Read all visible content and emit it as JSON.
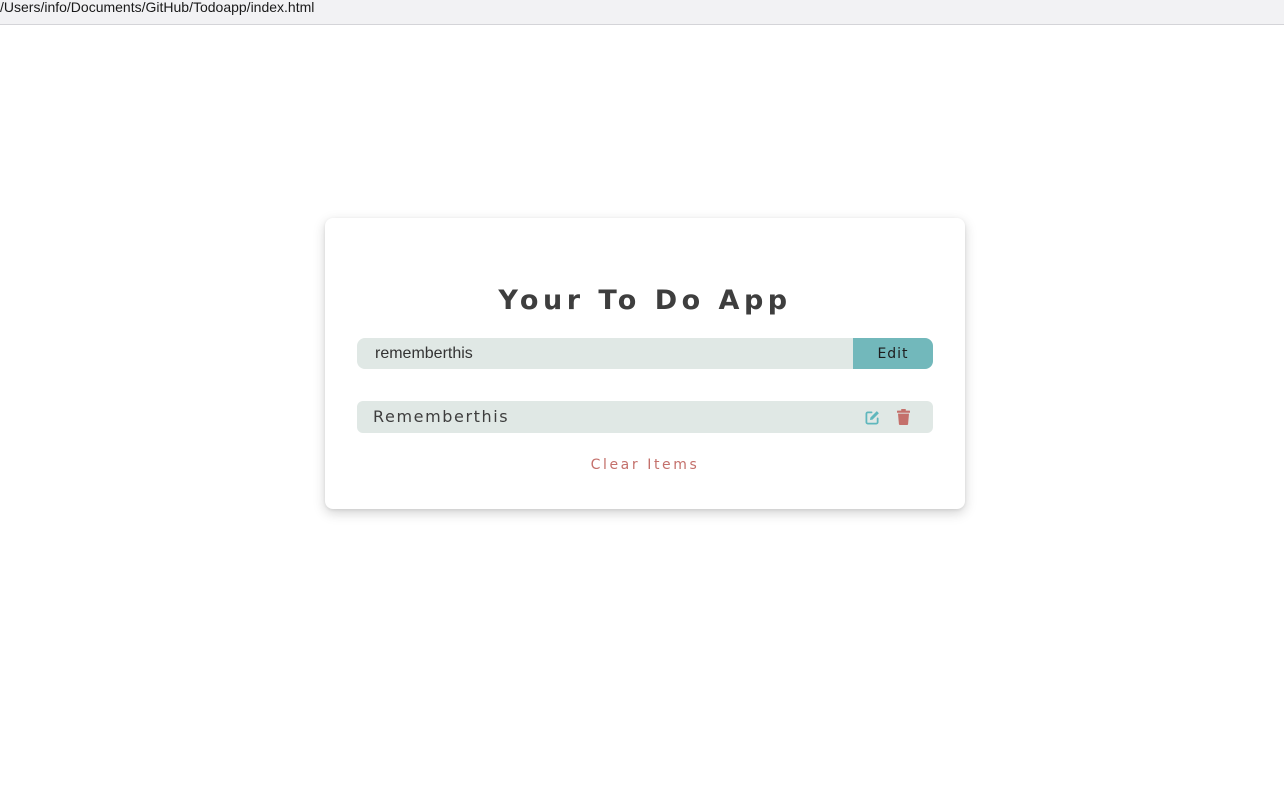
{
  "browser": {
    "url": "/Users/info/Documents/GitHub/Todoapp/index.html"
  },
  "app": {
    "title": "Your To Do App",
    "input": {
      "value": "rememberthis",
      "placeholder": ""
    },
    "submit_label": "Edit",
    "items": [
      {
        "text": "Rememberthis",
        "icons": [
          "edit-icon",
          "trash-icon"
        ]
      }
    ],
    "clear_label": "Clear Items"
  },
  "colors": {
    "accent": "#72b8bb",
    "item_bg": "#e0e8e5",
    "edit_icon": "#5fb7bd",
    "delete_icon": "#c4706b",
    "clear_text": "#c4706b",
    "title_text": "#3e3e3e"
  }
}
